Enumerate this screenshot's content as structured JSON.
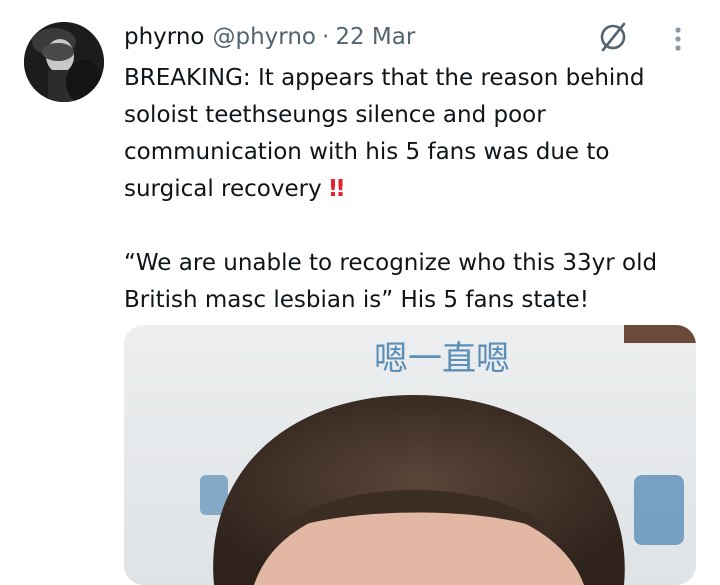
{
  "tweet": {
    "display_name": "phyrno",
    "handle": "@phyrno",
    "separator": "·",
    "timestamp": "22 Mar",
    "text_line1": "BREAKING: It appears that the reason behind soloist teethseungs silence and poor communication with his 5 fans was due to surgical recovery",
    "emphasis_emoji": "!!",
    "text_line2": "“We are unable to recognize who this 33yr old British masc lesbian is” His 5 fans state!",
    "media_caption_text": "嗯一直嗯",
    "icons": [
      "avatar",
      "grok-icon",
      "more-options-icon"
    ]
  },
  "colors": {
    "text": "#0f1419",
    "secondary": "#536471",
    "emoji_red": "#e0232e",
    "media_bg": "#e9ebee"
  }
}
